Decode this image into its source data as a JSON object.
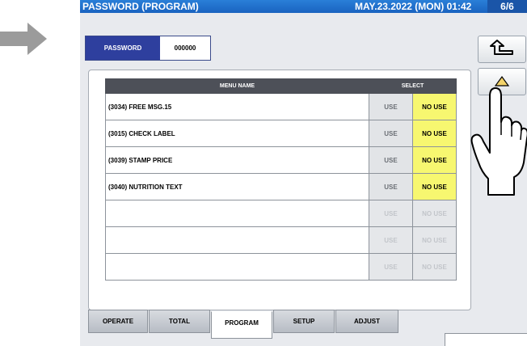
{
  "header": {
    "title": "PASSWORD (PROGRAM)",
    "datetime": "MAY.23.2022 (MON) 01:42",
    "page": "6/6"
  },
  "password": {
    "label": "PASSWORD",
    "value": "000000"
  },
  "side_buttons": {
    "back_icon": "return-arrow-icon",
    "up_icon": "up-triangle-icon"
  },
  "table": {
    "columns": [
      "MENU NAME",
      "SELECT"
    ],
    "rows": [
      {
        "name": "(3034) FREE MSG.15",
        "use": "USE",
        "no_use": "NO USE",
        "selected": "NO USE"
      },
      {
        "name": "(3015) CHECK LABEL",
        "use": "USE",
        "no_use": "NO USE",
        "selected": "NO USE"
      },
      {
        "name": "(3039) STAMP PRICE",
        "use": "USE",
        "no_use": "NO USE",
        "selected": "NO USE"
      },
      {
        "name": "(3040) NUTRITION TEXT",
        "use": "USE",
        "no_use": "NO USE",
        "selected": "NO USE"
      },
      {
        "name": "",
        "use": "USE",
        "no_use": "NO USE",
        "selected": ""
      },
      {
        "name": "",
        "use": "USE",
        "no_use": "NO USE",
        "selected": ""
      },
      {
        "name": "",
        "use": "USE",
        "no_use": "NO USE",
        "selected": ""
      }
    ]
  },
  "tabs": [
    {
      "label": "OPERATE"
    },
    {
      "label": "TOTAL"
    },
    {
      "label": "PROGRAM"
    },
    {
      "label": "SETUP"
    },
    {
      "label": "ADJUST"
    }
  ],
  "active_tab": "PROGRAM",
  "colors": {
    "title_bar": "#1a63c0",
    "password_label": "#2e3f9e",
    "selected": "#f7f770",
    "header": "#4d5058"
  }
}
